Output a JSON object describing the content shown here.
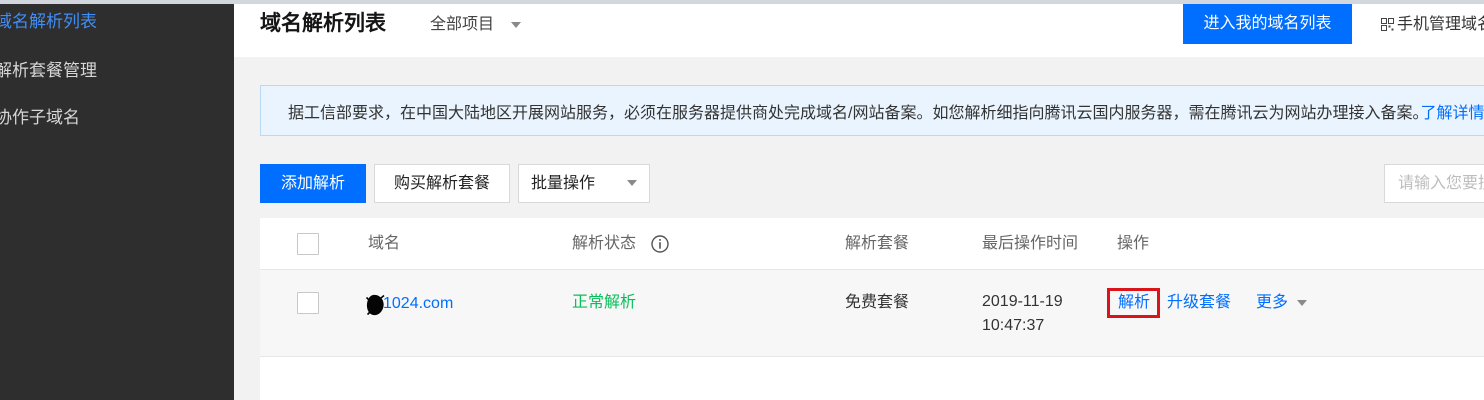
{
  "sidebar": {
    "items": [
      {
        "label": "域名解析列表",
        "active": true
      },
      {
        "label": "解析套餐管理",
        "active": false
      },
      {
        "label": "协作子域名",
        "active": false
      }
    ]
  },
  "header": {
    "title": "域名解析列表",
    "project_filter": {
      "selected": "全部项目",
      "icon": "caret-down-icon"
    },
    "enter_domain_list_button": "进入我的域名列表",
    "mobile_manage": {
      "label": "手机管理域名",
      "icon": "qr-code-icon"
    }
  },
  "notice": {
    "text": "据工信部要求，在中国大陆地区开展网站服务，必须在服务器提供商处完成域名/网站备案。如您解析细指向腾讯云国内服务器，需在腾讯云为网站办理接入备案。",
    "link": "了解详情"
  },
  "toolbar": {
    "add_record_button": "添加解析",
    "buy_package_button": "购买解析套餐",
    "batch_operations": {
      "selected": "批量操作",
      "icon": "caret-down-icon"
    },
    "search": {
      "placeholder": "请输入您要搜",
      "value": ""
    }
  },
  "table": {
    "columns": {
      "domain": "域名",
      "status": "解析状态",
      "status_help_icon": "info-icon",
      "package": "解析套餐",
      "last_modified": "最后操作时间",
      "actions": "操作"
    },
    "select_all_checked": false,
    "rows": [
      {
        "checked": false,
        "domain": "1024.com",
        "status": "正常解析",
        "package": "免费套餐",
        "last_modified_date": "2019-11-19",
        "last_modified_time": "10:47:37",
        "actions": [
          {
            "label": "解析",
            "highlighted": true
          },
          {
            "label": "升级套餐",
            "highlighted": false
          },
          {
            "label": "更多",
            "highlighted": false,
            "icon": "caret-down-icon"
          }
        ]
      }
    ]
  },
  "colors": {
    "sidebar_bg": "#2e2e2e",
    "sidebar_active": "#3f8ef5",
    "accent": "#006eff",
    "status_ok": "#0abf5b",
    "highlight_box": "#d9141b",
    "notice_bg": "#e9f4fe",
    "page_bg": "#f2f2f2"
  }
}
